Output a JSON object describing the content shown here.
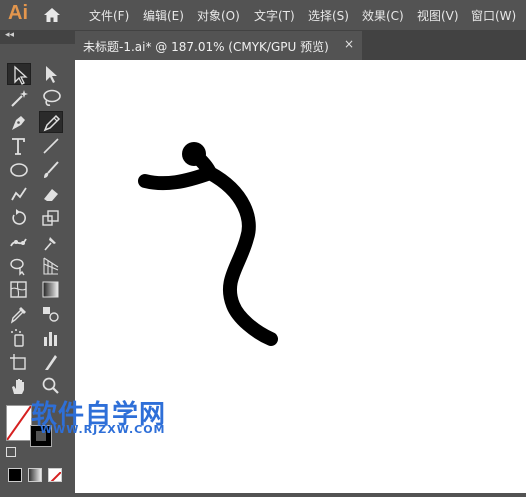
{
  "app": {
    "logo": "Ai"
  },
  "menu": [
    "文件(F)",
    "编辑(E)",
    "对象(O)",
    "文字(T)",
    "选择(S)",
    "效果(C)",
    "视图(V)",
    "窗口(W)"
  ],
  "document": {
    "tab_label": "未标题-1.ai* @ 187.01% (CMYK/GPU 预览)",
    "close_glyph": "×"
  },
  "toolbar": {
    "collapse_glyph": "◂◂"
  },
  "watermark": {
    "title": "软件自学网",
    "url": "WWW.RJZXW.COM"
  },
  "colors": {
    "accent_logo": "#e3964d",
    "watermark": "#2e6fd8",
    "stroke": "#000000"
  }
}
